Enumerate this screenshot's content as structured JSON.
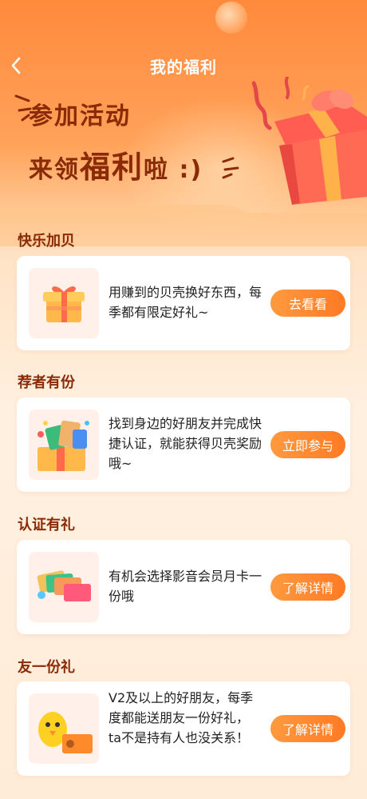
{
  "nav": {
    "title": "我的福利",
    "back_icon": "chevron-left-icon"
  },
  "hero": {
    "line1": "参加活动",
    "line2_prefix": "来领",
    "line2_highlight": "福利",
    "line2_suffix": "啦 :)"
  },
  "sections": [
    {
      "title": "快乐加贝",
      "description": "用赚到的贝壳换好东西，每季都有限定好礼~",
      "button": "去看看",
      "icon": "gift-box-icon"
    },
    {
      "title": "荐者有份",
      "description": "找到身边的好朋友并完成快捷认证，就能获得贝壳奖励哦~",
      "button": "立即参与",
      "icon": "gift-cards-box-icon"
    },
    {
      "title": "认证有礼",
      "description": "有机会选择影音会员月卡一份哦",
      "button": "了解详情",
      "icon": "membership-cards-icon"
    },
    {
      "title": "友一份礼",
      "description": "V2及以上的好朋友，每季度都能送朋友一份好礼，ta不是持有人也没关系！",
      "button": "了解详情",
      "icon": "chick-mascot-card-icon"
    }
  ],
  "colors": {
    "accent": "#ff7a24",
    "title_brown": "#8a2a06",
    "header_orange": "#ff8a3c"
  }
}
